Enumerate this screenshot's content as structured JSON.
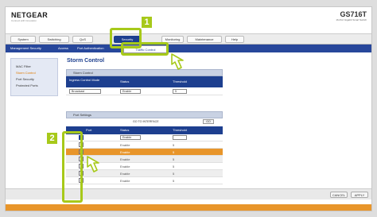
{
  "header": {
    "logo": "NETGEAR",
    "logo_sub": "Connect with Innovation",
    "model": "GS716T",
    "model_sub": "16-Port Gigabit Smart Switch"
  },
  "tabs": [
    "System",
    "Switching",
    "QoS",
    "Security",
    "Monitoring",
    "Maintenance",
    "Help"
  ],
  "active_tab": "Security",
  "subnav": [
    "Management Security",
    "Access",
    "Port Authentication",
    "Traffic Control"
  ],
  "subnav_popup": "Traffic Control",
  "leftnav": [
    "MAC Filter",
    "Storm Control",
    "Port Security",
    "Protected Ports"
  ],
  "leftnav_selected": "Storm Control",
  "page_title": "Storm Control",
  "storm_panel": {
    "title": "Storm Control",
    "headers": [
      "Ingress Control Mode",
      "Status",
      "Threshold"
    ],
    "values": [
      "Broadcast",
      "Enable",
      "5"
    ]
  },
  "port_panel": {
    "title": "Port Settings",
    "go_to": "GO TO INTERFACE",
    "go_btn": "GO",
    "headers": [
      "Port",
      "Status",
      "Threshold"
    ],
    "rows": [
      {
        "status": "Enable",
        "threshold": "5"
      },
      {
        "status": "Enable",
        "threshold": "5"
      },
      {
        "status": "Enable",
        "threshold": "5"
      },
      {
        "status": "Enable",
        "threshold": "5"
      },
      {
        "status": "Enable",
        "threshold": "5"
      },
      {
        "status": "Enable",
        "threshold": "5"
      },
      {
        "status": "Enable",
        "threshold": "5"
      }
    ]
  },
  "footer_buttons": [
    "CANCEL",
    "APPLY"
  ],
  "callouts": [
    "1",
    "2"
  ],
  "colors": {
    "brand": "#1d3f8f",
    "accent": "#e8952a",
    "callout": "#a7c91a"
  }
}
